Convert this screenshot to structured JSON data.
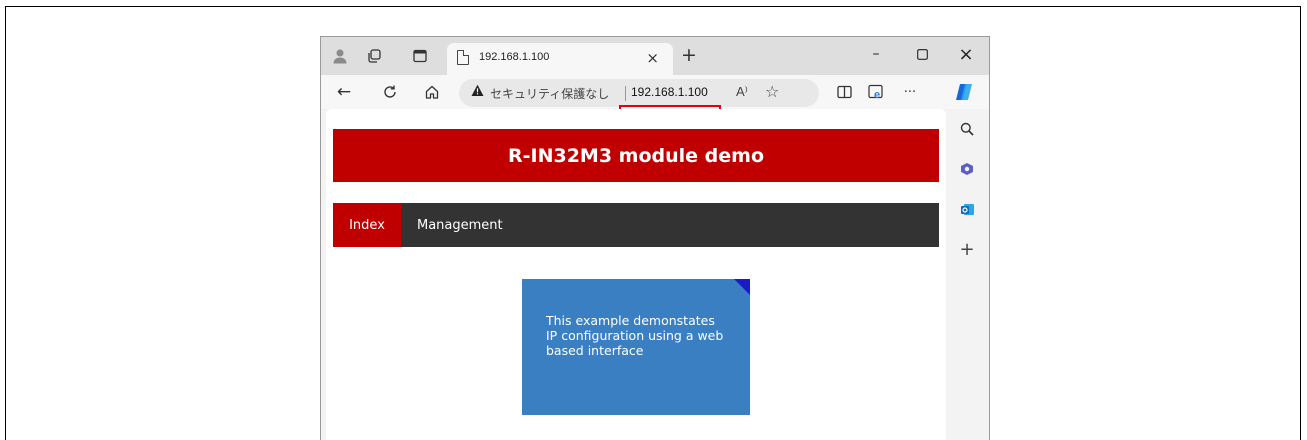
{
  "browser": {
    "tab": {
      "title": "192.168.1.100",
      "close_glyph": "×"
    },
    "new_tab_glyph": "+",
    "window_controls": {
      "minimize": "–",
      "maximize": "▢",
      "close": "×"
    },
    "address": {
      "insecure_label": "セキュリティ保護なし",
      "url": "192.168.1.100",
      "read_aloud": "A⁾"
    },
    "icons": {
      "profile": "profile-icon",
      "workspaces": "workspaces-icon",
      "tab-actions": "tab-actions-icon",
      "back": "←",
      "refresh": "C",
      "home": "⌂",
      "favorite": "☆",
      "split-screen": "split-screen-icon",
      "ie-mode": "ie-mode-icon",
      "more": "···",
      "copilot": "copilot-icon",
      "search": "search-icon",
      "office": "office-icon",
      "outlook": "outlook-icon",
      "add": "+"
    },
    "highlight_color": "#e60012"
  },
  "page": {
    "header_title": "R-IN32M3 module demo",
    "nav": [
      {
        "label": "Index"
      },
      {
        "label": "Management"
      }
    ],
    "note_text": "This example demonstates IP configuration using a web based interface",
    "colors": {
      "header": "#c00000",
      "nav": "#333333",
      "note": "#3a7fc1",
      "note_corner": "#1a1ac8"
    }
  }
}
